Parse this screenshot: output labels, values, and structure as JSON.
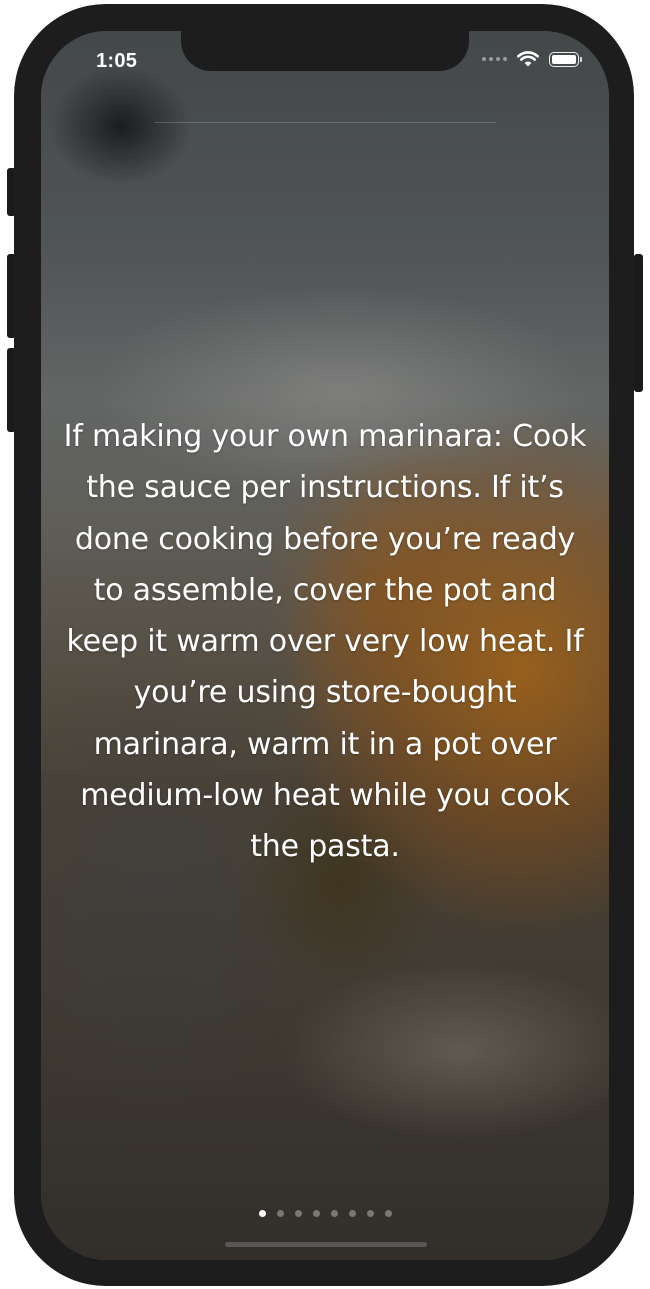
{
  "status_bar": {
    "time": "1:05",
    "icons": [
      "cellular-signal-icon",
      "wifi-icon",
      "battery-icon"
    ]
  },
  "step": {
    "text": "If making your own marinara: Cook the sauce per instructions. If it’s done cooking before you’re ready to assemble, cover the pot and keep it warm over very low heat. If you’re using store-bought marinara, warm it in a pot over medium-low heat while you cook the pasta."
  },
  "pagination": {
    "total": 8,
    "current": 1
  },
  "colors": {
    "text": "#ffffff",
    "device_frame": "#1d1d1d"
  }
}
